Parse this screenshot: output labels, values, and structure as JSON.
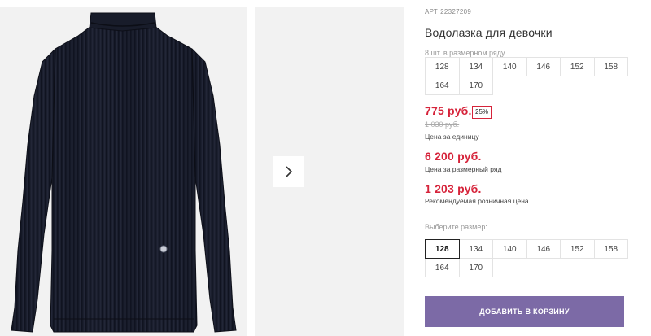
{
  "product": {
    "art_label": "АРТ",
    "art_number": "22327209",
    "title": "Водолазка для девочки",
    "pack_note": "8 шт. в размерном ряду"
  },
  "pack_sizes": [
    "128",
    "134",
    "140",
    "146",
    "152",
    "158",
    "164",
    "170"
  ],
  "prices": {
    "unit_price": "775 руб.",
    "discount": "25%",
    "old_price": "1 030 руб.",
    "unit_caption": "Цена за единицу",
    "set_price": "6 200 руб.",
    "set_caption": "Цена за размерный ряд",
    "recommended_price": "1 203 руб.",
    "recommended_caption": "Рекомендуемая розничная цена"
  },
  "size_selector": {
    "label": "Выберите размер:",
    "options": [
      "128",
      "134",
      "140",
      "146",
      "152",
      "158",
      "164",
      "170"
    ],
    "selected": "128"
  },
  "cart_button": "ДОБАВИТЬ В КОРЗИНУ",
  "colors": {
    "price_red": "#d6233a",
    "button_purple": "#7c6aa6",
    "sweater_navy": "#1a1e2c"
  },
  "icons": {
    "next": "chevron-right-icon",
    "logo_badge": "brand-badge-icon"
  }
}
